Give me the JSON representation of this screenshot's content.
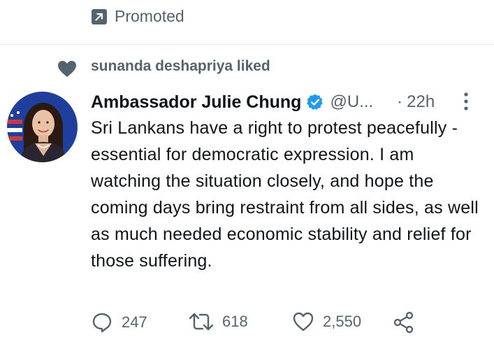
{
  "promoted": {
    "label": "Promoted",
    "icon": "arrow-up-right-box-icon"
  },
  "social_context": {
    "text": "sunanda deshapriya liked",
    "icon": "heart-filled-icon"
  },
  "tweet": {
    "author": {
      "display_name": "Ambassador Julie Chung",
      "verified": true,
      "handle": "@U...",
      "avatar": "profile-photo"
    },
    "separator": "·",
    "time": "22h",
    "text": "Sri Lankans have a right to protest peacefully - essential for democratic expression. I am watching the situation closely, and hope the coming days bring restraint from all sides, as well as much needed economic stability and relief for those suffering.",
    "actions": {
      "replies": "247",
      "retweets": "618",
      "likes": "2,550"
    }
  },
  "colors": {
    "secondary_text": "#536471",
    "primary_text": "#0f1419",
    "verified_blue": "#1d9bf0",
    "divider": "#e6e9ec"
  }
}
